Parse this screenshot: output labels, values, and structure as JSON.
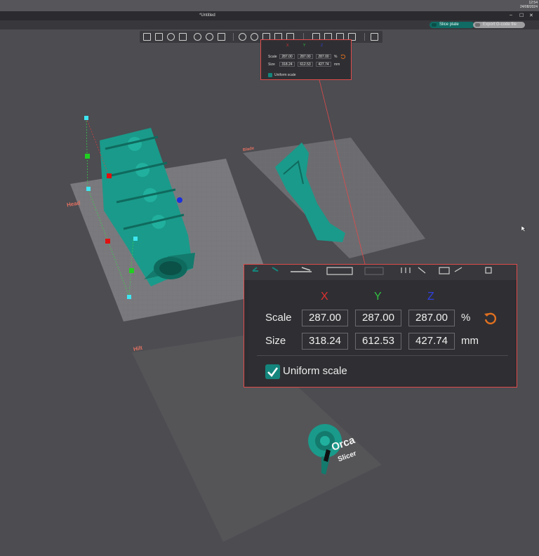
{
  "system": {
    "time": "12:54",
    "date": "24/08/2024"
  },
  "window": {
    "title": "*Untitled",
    "controls": [
      "–",
      "☐",
      "✕"
    ]
  },
  "topbar": {
    "slice_label": "Slice plate",
    "export_label": "Export G-code file"
  },
  "plates": {
    "head": "Head",
    "blade": "Blade",
    "hilt": "Hilt"
  },
  "logo": {
    "line1": "Orca",
    "line2": "Slicer"
  },
  "mini_panel": {
    "axes": [
      "X",
      "Y",
      "Z"
    ],
    "scale_label": "Scale",
    "size_label": "Size",
    "scale": [
      "287.00",
      "287.00",
      "287.00"
    ],
    "scale_unit": "%",
    "size": [
      "318.24",
      "612.53",
      "427.74"
    ],
    "size_unit": "mm",
    "uniform_label": "Uniform scale",
    "uniform_checked": true
  },
  "scale_panel": {
    "axes": [
      "X",
      "Y",
      "Z"
    ],
    "axis_colors": [
      "#e03030",
      "#30c040",
      "#3040e0"
    ],
    "scale_label": "Scale",
    "size_label": "Size",
    "scale": [
      "287.00",
      "287.00",
      "287.00"
    ],
    "scale_unit": "%",
    "size": [
      "318.24",
      "612.53",
      "427.74"
    ],
    "size_unit": "mm",
    "uniform_label": "Uniform scale",
    "uniform_checked": true
  },
  "icons": {
    "toolbar": [
      "add-cube-icon",
      "grid-icon",
      "orient-icon",
      "image-icon",
      "arrange-icon",
      "split-icon",
      "layers-icon",
      "move-icon",
      "rotate-icon",
      "scale-icon",
      "cut-icon",
      "paint-icon",
      "seam-icon",
      "text-icon",
      "measure-icon",
      "assembly-icon"
    ],
    "reset": "reset-icon"
  },
  "colors": {
    "accent": "#14857c",
    "model": "#1a9a8a",
    "highlight": "#e04a4a",
    "reset": "#e07020"
  }
}
